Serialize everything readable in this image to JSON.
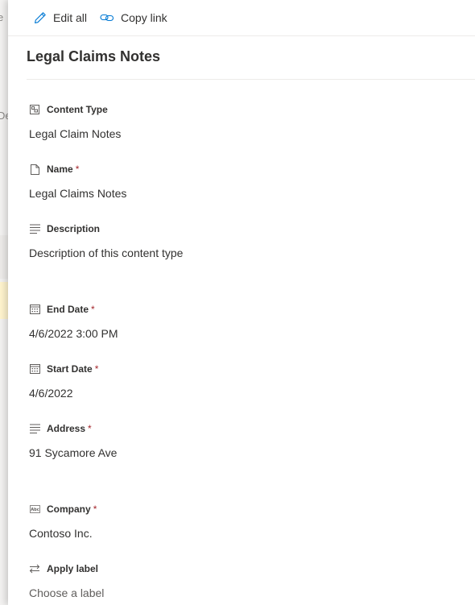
{
  "background": {
    "fragments": [
      "e",
      "De"
    ]
  },
  "toolbar": {
    "edit_all_label": "Edit all",
    "copy_link_label": "Copy link"
  },
  "panel": {
    "title": "Legal Claims Notes"
  },
  "fields": [
    {
      "label": "Content Type",
      "required": false,
      "value": "Legal Claim Notes",
      "icon": "content-type-icon"
    },
    {
      "label": "Name",
      "required": true,
      "value": "Legal Claims Notes",
      "icon": "document-icon"
    },
    {
      "label": "Description",
      "required": false,
      "value": "Description of this content type",
      "icon": "text-lines-icon"
    },
    {
      "label": "End Date",
      "required": true,
      "value": "4/6/2022 3:00 PM",
      "icon": "calendar-icon"
    },
    {
      "label": "Start Date",
      "required": true,
      "value": "4/6/2022",
      "icon": "calendar-icon"
    },
    {
      "label": "Address",
      "required": true,
      "value": "91 Sycamore Ave",
      "icon": "text-lines-icon"
    },
    {
      "label": "Company",
      "required": true,
      "value": "Contoso Inc.",
      "icon": "abc-text-icon"
    },
    {
      "label": "Apply label",
      "required": false,
      "value": "Choose a label",
      "icon": "swap-arrows-icon"
    }
  ],
  "required_marker": "*",
  "colors": {
    "required": "#a4262c",
    "text": "#323130",
    "divider": "#edebe9"
  }
}
